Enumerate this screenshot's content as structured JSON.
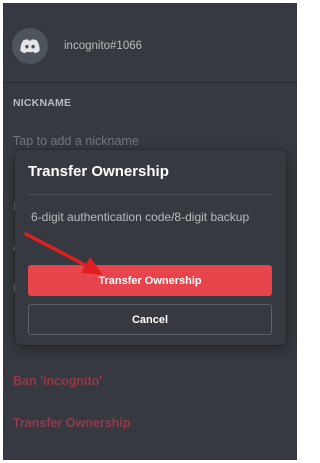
{
  "user": {
    "avatar_icon": "discord-logo-icon",
    "username": "incognito#1066"
  },
  "nickname_section": {
    "heading": "NICKNAME",
    "placeholder": "Tap to add a nickname"
  },
  "danger_actions": {
    "ban": "Ban 'incognito'",
    "transfer": "Transfer Ownership"
  },
  "modal": {
    "title": "Transfer Ownership",
    "code_placeholder": "6-digit authentication code/8-digit backup",
    "confirm_label": "Transfer Ownership",
    "cancel_label": "Cancel"
  },
  "annotation": {
    "arrow_color": "#e02020"
  },
  "colors": {
    "background": "#36393f",
    "primary_button": "#e8444c",
    "danger_text": "#93394a"
  }
}
